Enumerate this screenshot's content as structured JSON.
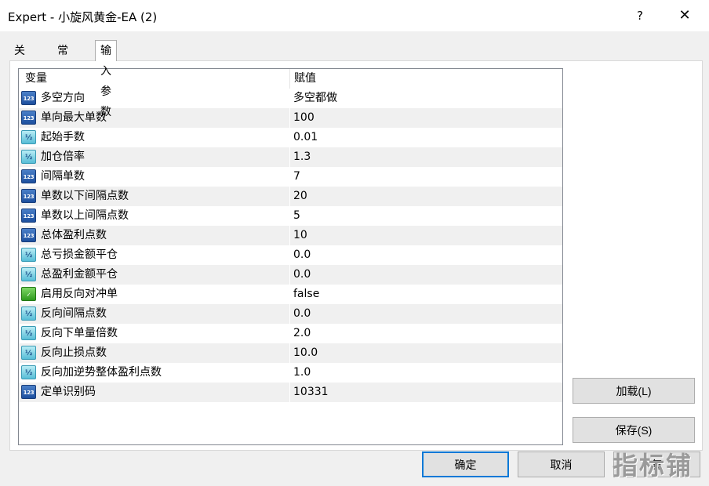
{
  "window": {
    "title": "Expert - 小旋风黄金-EA (2)",
    "help_label": "?",
    "close_label": "✕"
  },
  "tabs": [
    {
      "label": "关于",
      "active": false
    },
    {
      "label": "常用",
      "active": false
    },
    {
      "label": "输入参数",
      "active": true
    }
  ],
  "grid": {
    "headers": {
      "variable": "变量",
      "value": "赋值"
    },
    "rows": [
      {
        "icon": "int-type-icon",
        "icon_text": "123",
        "name": "多空方向",
        "value": "多空都做"
      },
      {
        "icon": "int-type-icon",
        "icon_text": "123",
        "name": "单向最大单数",
        "value": "100"
      },
      {
        "icon": "double-type-icon",
        "icon_text": "½",
        "name": "起始手数",
        "value": "0.01"
      },
      {
        "icon": "double-type-icon",
        "icon_text": "½",
        "name": "加仓倍率",
        "value": "1.3"
      },
      {
        "icon": "int-type-icon",
        "icon_text": "123",
        "name": "间隔单数",
        "value": "7"
      },
      {
        "icon": "int-type-icon",
        "icon_text": "123",
        "name": "单数以下间隔点数",
        "value": "20"
      },
      {
        "icon": "int-type-icon",
        "icon_text": "123",
        "name": "单数以上间隔点数",
        "value": "5"
      },
      {
        "icon": "int-type-icon",
        "icon_text": "123",
        "name": "总体盈利点数",
        "value": "10"
      },
      {
        "icon": "double-type-icon",
        "icon_text": "½",
        "name": "总亏损金额平仓",
        "value": "0.0"
      },
      {
        "icon": "double-type-icon",
        "icon_text": "½",
        "name": "总盈利金额平仓",
        "value": "0.0"
      },
      {
        "icon": "bool-type-icon",
        "icon_text": "✓",
        "name": "启用反向对冲单",
        "value": "false"
      },
      {
        "icon": "double-type-icon",
        "icon_text": "½",
        "name": "反向间隔点数",
        "value": "0.0"
      },
      {
        "icon": "double-type-icon",
        "icon_text": "½",
        "name": "反向下单量倍数",
        "value": "2.0"
      },
      {
        "icon": "double-type-icon",
        "icon_text": "½",
        "name": "反向止损点数",
        "value": "10.0"
      },
      {
        "icon": "double-type-icon",
        "icon_text": "½",
        "name": "反向加逆势整体盈利点数",
        "value": "1.0"
      },
      {
        "icon": "int-type-icon",
        "icon_text": "123",
        "name": "定单识别码",
        "value": "10331"
      }
    ]
  },
  "buttons": {
    "load": "加载(L)",
    "save": "保存(S)",
    "ok": "确定",
    "cancel": "取消",
    "reset": "复"
  },
  "watermark": "指标铺",
  "colors": {
    "accent": "#0078d7",
    "alt_row": "#f0f0f0",
    "background": "#f0f0f0"
  }
}
